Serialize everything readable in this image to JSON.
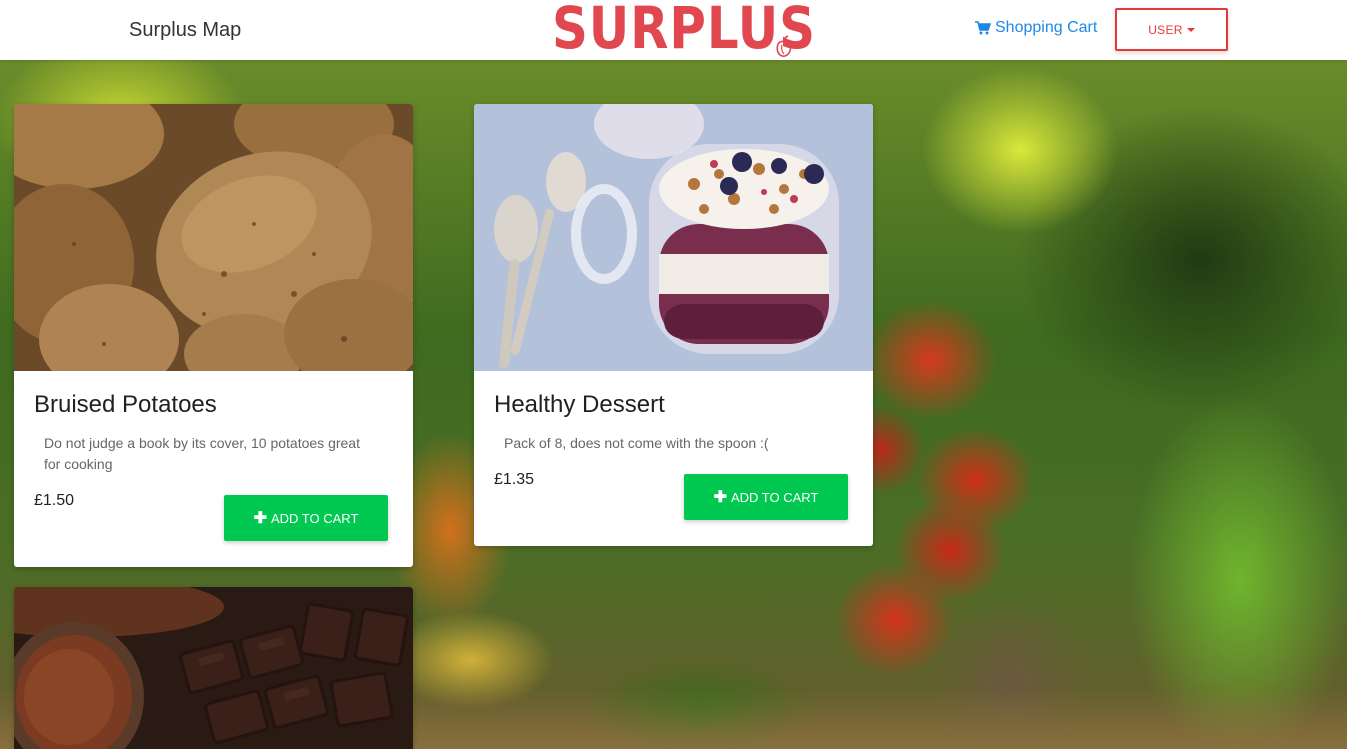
{
  "header": {
    "brand_link": "Surplus Map",
    "logo_text": "SURPLUS",
    "cart_label": "Shopping Cart",
    "user_label": "USER"
  },
  "products": [
    {
      "title": "Bruised Potatoes",
      "description": "Do not judge a book by its cover, 10 potatoes great for cooking",
      "price": "£1.50",
      "button_label": "ADD TO CART",
      "image": "potatoes-photo"
    },
    {
      "title": "Healthy Dessert",
      "description": "Pack of 8, does not come with the spoon :(",
      "price": "£1.35",
      "button_label": "ADD TO CART",
      "image": "yogurt-parfait-photo"
    },
    {
      "image": "chocolate-photo"
    }
  ],
  "colors": {
    "brand": "#e1474f",
    "link": "#1e88e5",
    "add_button": "#00c851",
    "user_button": "#e53935"
  }
}
